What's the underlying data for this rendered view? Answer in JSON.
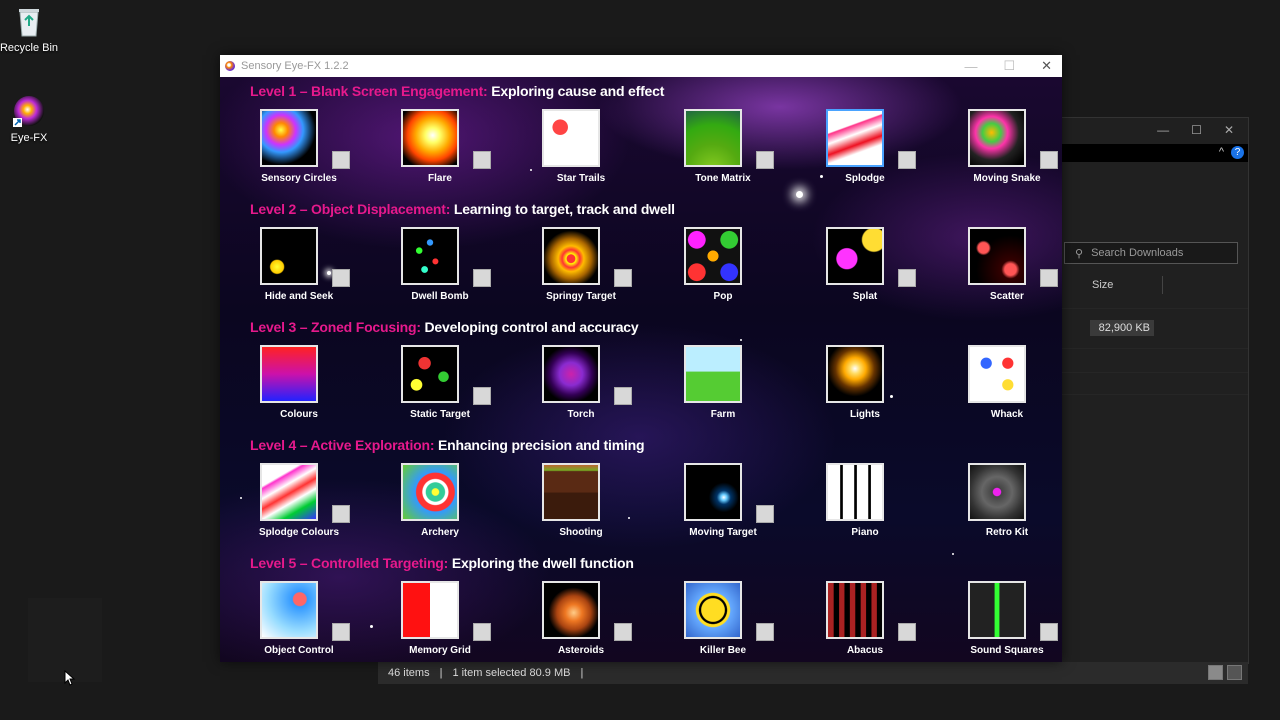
{
  "desktop": {
    "icons": [
      {
        "label": "Recycle Bin",
        "icon": "recycle-bin-icon"
      },
      {
        "label": "Eye-FX",
        "icon": "eye-fx-icon"
      }
    ]
  },
  "app": {
    "title": "Sensory Eye-FX 1.2.2",
    "levels": [
      {
        "heading_accent": "Level 1 – Blank Screen Engagement:",
        "heading_text": " Exploring cause and effect",
        "items": [
          {
            "label": "Sensory Circles",
            "checkbox": true
          },
          {
            "label": "Flare",
            "checkbox": true
          },
          {
            "label": "Star Trails",
            "checkbox": false
          },
          {
            "label": "Tone Matrix",
            "checkbox": true
          },
          {
            "label": "Splodge",
            "checkbox": true,
            "selected": true
          },
          {
            "label": "Moving Snake",
            "checkbox": true
          }
        ]
      },
      {
        "heading_accent": "Level 2 – Object Displacement:",
        "heading_text": " Learning to target, track and dwell",
        "items": [
          {
            "label": "Hide and Seek",
            "checkbox": true
          },
          {
            "label": "Dwell Bomb",
            "checkbox": true
          },
          {
            "label": "Springy Target",
            "checkbox": true
          },
          {
            "label": "Pop",
            "checkbox": false
          },
          {
            "label": "Splat",
            "checkbox": true
          },
          {
            "label": "Scatter",
            "checkbox": true
          }
        ]
      },
      {
        "heading_accent": "Level 3 – Zoned Focusing:",
        "heading_text": " Developing control and accuracy",
        "items": [
          {
            "label": "Colours",
            "checkbox": false
          },
          {
            "label": "Static Target",
            "checkbox": true
          },
          {
            "label": "Torch",
            "checkbox": true
          },
          {
            "label": "Farm",
            "checkbox": false
          },
          {
            "label": "Lights",
            "checkbox": false
          },
          {
            "label": "Whack",
            "checkbox": false
          }
        ]
      },
      {
        "heading_accent": "Level 4 – Active Exploration:",
        "heading_text": " Enhancing precision and timing",
        "items": [
          {
            "label": "Splodge Colours",
            "checkbox": true
          },
          {
            "label": "Archery",
            "checkbox": false
          },
          {
            "label": "Shooting",
            "checkbox": false
          },
          {
            "label": "Moving Target",
            "checkbox": true
          },
          {
            "label": "Piano",
            "checkbox": false
          },
          {
            "label": "Retro Kit",
            "checkbox": false
          }
        ]
      },
      {
        "heading_accent": "Level 5 – Controlled Targeting:",
        "heading_text": " Exploring the dwell function",
        "items": [
          {
            "label": "Object Control",
            "checkbox": true
          },
          {
            "label": "Memory Grid",
            "checkbox": true
          },
          {
            "label": "Asteroids",
            "checkbox": true
          },
          {
            "label": "Killer Bee",
            "checkbox": true
          },
          {
            "label": "Abacus",
            "checkbox": true
          },
          {
            "label": "Sound Squares",
            "checkbox": true
          }
        ]
      }
    ]
  },
  "explorer": {
    "search_placeholder": "Search Downloads",
    "column_size": "Size",
    "file_size": "82,900 KB",
    "status": {
      "items": "46 items",
      "selected": "1 item selected  80.9 MB"
    }
  },
  "colors": {
    "accent_pink": "#e6198c",
    "selection_blue": "#4aa3ff"
  }
}
